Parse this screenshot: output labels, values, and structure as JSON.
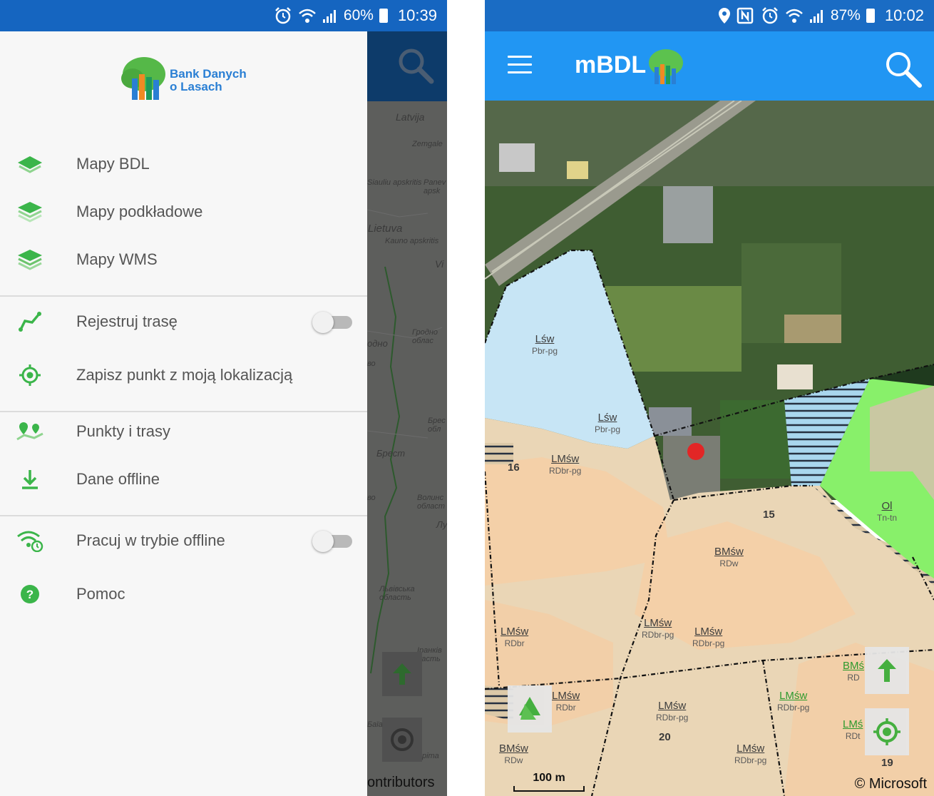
{
  "left_screen": {
    "status": {
      "wifi_label": "wifi-signal",
      "battery": "60%",
      "time": "10:39"
    },
    "logo_text_line1": "Bank Danych",
    "logo_text_line2": "o Lasach",
    "menu": [
      {
        "label": "Mapy BDL",
        "icon": "layers-icon"
      },
      {
        "label": "Mapy podkładowe",
        "icon": "base-layers-icon"
      },
      {
        "label": "Mapy WMS",
        "icon": "wms-layers-icon"
      },
      {
        "label": "Rejestruj trasę",
        "icon": "route-icon",
        "toggle": false
      },
      {
        "label": "Zapisz punkt z moją lokalizacją",
        "icon": "target-location-icon"
      },
      {
        "label": "Punkty i trasy",
        "icon": "points-map-icon"
      },
      {
        "label": "Dane offline",
        "icon": "download-icon"
      },
      {
        "label": "Pracuj w trybie offline",
        "icon": "wifi-offline-icon",
        "toggle": false
      },
      {
        "label": "Pomoc",
        "icon": "help-icon"
      }
    ],
    "map_labels": [
      "Latvija",
      "Zemgale",
      "Siauliu apskritis",
      "Panev apsk",
      "Lietuva",
      "Kauno apskritis",
      "Vi",
      "Гродно облас",
      "одно",
      "во",
      "Брест",
      "Брес обл",
      "во",
      "Волинс област",
      "Лу",
      "Львівська область",
      "Іранків ласть",
      "Баїа",
      "ріта"
    ],
    "attribution": "ontributors"
  },
  "right_screen": {
    "status": {
      "battery": "87%",
      "time": "10:02"
    },
    "app_title": "mBDL",
    "map_labels": [
      {
        "top": "Lśw",
        "bottom": "Pbr-pg",
        "green": false
      },
      {
        "top": "Lśw",
        "bottom": "Pbr-pg",
        "green": false
      },
      {
        "top": "LMśw",
        "bottom": "RDbr-pg",
        "green": false
      },
      {
        "top": "BMśw",
        "bottom": "RDw",
        "green": false
      },
      {
        "top": "Ol",
        "bottom": "Tn-tn",
        "green": false
      },
      {
        "top": "LMśw",
        "bottom": "RDbr",
        "green": false
      },
      {
        "top": "LMśw",
        "bottom": "RDbr-pg",
        "green": false
      },
      {
        "top": "LMśw",
        "bottom": "RDbr-pg",
        "green": false
      },
      {
        "top": "LMśw",
        "bottom": "RDbr",
        "green": false
      },
      {
        "top": "LMśw",
        "bottom": "RDbr-pg",
        "green": false
      },
      {
        "top": "LMśw",
        "bottom": "RDbr-pg",
        "green": true
      },
      {
        "top": "BMś",
        "bottom": "RD",
        "green": true
      },
      {
        "top": "LMś",
        "bottom": "RDt",
        "green": true
      },
      {
        "top": "BMśw",
        "bottom": "RDw",
        "green": false
      },
      {
        "top": "LMśw",
        "bottom": "RDbr-pg",
        "green": false
      }
    ],
    "numbers": [
      "16",
      "15",
      "20",
      "19"
    ],
    "scale_label": "100 m",
    "copyright": "© Microsoft"
  }
}
